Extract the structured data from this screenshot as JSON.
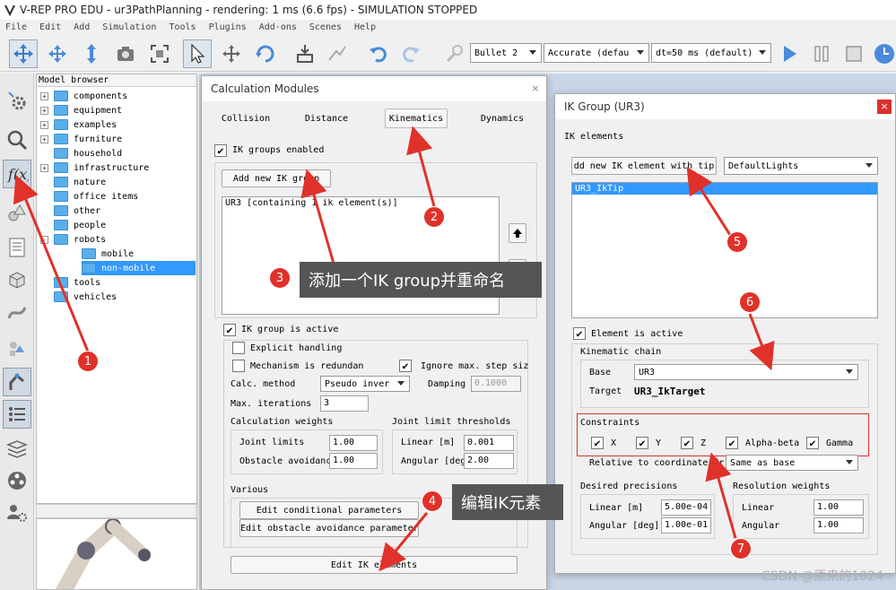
{
  "window": {
    "title": "V-REP PRO EDU - ur3PathPlanning - rendering: 1 ms (6.6 fps) - SIMULATION STOPPED"
  },
  "menu": [
    "File",
    "Edit",
    "Add",
    "Simulation",
    "Tools",
    "Plugins",
    "Add-ons",
    "Scenes",
    "Help"
  ],
  "toolbar": {
    "engine": "Bullet 2",
    "accuracy": "Accurate (defau",
    "dt": "dt=50 ms (default)"
  },
  "model_browser": {
    "header": "Model browser",
    "items": [
      {
        "label": "components",
        "expand": "+"
      },
      {
        "label": "equipment",
        "expand": "+"
      },
      {
        "label": "examples",
        "expand": "+"
      },
      {
        "label": "furniture",
        "expand": "+"
      },
      {
        "label": "household",
        "expand": ""
      },
      {
        "label": "infrastructure",
        "expand": "+"
      },
      {
        "label": "nature",
        "expand": ""
      },
      {
        "label": "office items",
        "expand": ""
      },
      {
        "label": "other",
        "expand": ""
      },
      {
        "label": "people",
        "expand": ""
      },
      {
        "label": "robots",
        "expand": "-"
      },
      {
        "label": "mobile",
        "expand": ""
      },
      {
        "label": "non-mobile",
        "expand": ""
      },
      {
        "label": "tools",
        "expand": ""
      },
      {
        "label": "vehicles",
        "expand": ""
      }
    ]
  },
  "calc_modules": {
    "title": "Calculation Modules",
    "tabs": [
      "Collision",
      "Distance",
      "Kinematics",
      "Dynamics"
    ],
    "ik_groups_enabled": "IK groups enabled",
    "add_group_button": "Add new IK group",
    "group_list_item": "UR3 [containing 1 ik element(s)]",
    "group_active": "IK group is active",
    "explicit_handling": "Explicit handling",
    "mechanism_redundant": "Mechanism is redundan",
    "ignore_max_step": "Ignore max. step siz",
    "calc_method_label": "Calc. method",
    "calc_method_value": "Pseudo inver",
    "damping_label": "Damping",
    "damping_value": "0.1000",
    "max_iterations_label": "Max. iterations",
    "max_iterations_value": "3",
    "calc_weights_title": "Calculation weights",
    "joint_limits_label": "Joint limits",
    "joint_limits_value": "1.00",
    "obstacle_label": "Obstacle avoidanc",
    "obstacle_value": "1.00",
    "jlt_title": "Joint limit thresholds",
    "linear_label": "Linear [m]",
    "linear_value": "0.001",
    "angular_label": "Angular [deg]",
    "angular_value": "2.00",
    "various_title": "Various",
    "edit_conditional": "Edit conditional parameters",
    "edit_obstacle": "Edit obstacle avoidance parameters",
    "edit_ik_elements": "Edit IK elements"
  },
  "ik_group": {
    "title": "IK Group (UR3)",
    "elements_label": "IK elements",
    "add_element_button": "dd new IK element with tip",
    "dummy_select": "DefaultLights",
    "elements": [
      "UR3_IkTip"
    ],
    "element_active": "Element is active",
    "kinematic_chain_title": "Kinematic chain",
    "base_label": "Base",
    "base_value": "UR3",
    "target_label": "Target",
    "target_value": "UR3_IkTarget",
    "constraints_title": "Constraints",
    "constraints": [
      "X",
      "Y",
      "Z",
      "Alpha-beta",
      "Gamma"
    ],
    "relative_label": "Relative to coordinate fr",
    "relative_value": "Same as base",
    "desired_precisions_title": "Desired precisions",
    "dp_linear_label": "Linear [m]",
    "dp_linear_value": "5.00e-04",
    "dp_angular_label": "Angular [deg]",
    "dp_angular_value": "1.00e-01",
    "resolution_weights_title": "Resolution weights",
    "rw_linear_label": "Linear",
    "rw_linear_value": "1.00",
    "rw_angular_label": "Angular",
    "rw_angular_value": "1.00"
  },
  "annotations": {
    "markers": [
      "1",
      "2",
      "3",
      "4",
      "5",
      "6",
      "7"
    ],
    "callout_3": "添加一个IK group并重命名",
    "callout_4": "编辑IK元素",
    "watermark": "CSDN @原来的1024"
  },
  "colors": {
    "annotation_red": "#e0312a",
    "selection_blue": "#3399ff",
    "folder_blue": "#5aaeea"
  }
}
